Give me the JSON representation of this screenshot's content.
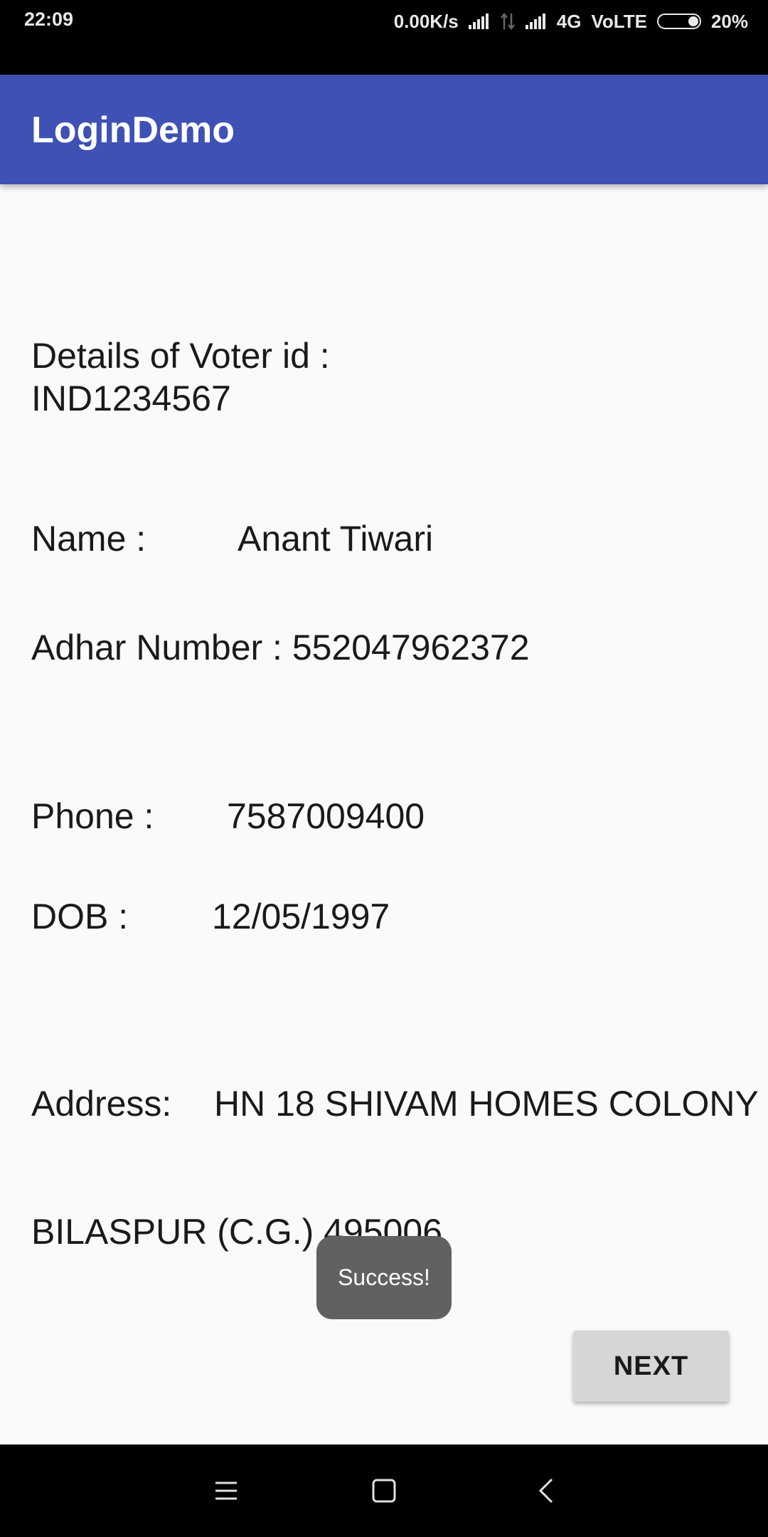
{
  "status_bar": {
    "time": "22:09",
    "speed": "0.00K/s",
    "network": "4G",
    "volte": "VoLTE",
    "battery": "20%"
  },
  "app_bar": {
    "title": "LoginDemo"
  },
  "details": {
    "heading": "Details of Voter id :\nIND1234567",
    "name_label": "Name :",
    "name_value": "Anant Tiwari",
    "adhar_text": "Adhar Number : 552047962372",
    "phone_label": "Phone :",
    "phone_value": "7587009400",
    "dob_label": "DOB :",
    "dob_value": "12/05/1997",
    "address_label": "Address:",
    "address_value": "HN 18 SHIVAM HOMES COLONY",
    "address_line2": "BILASPUR (C.G.) 495006"
  },
  "toast": {
    "message": "Success!"
  },
  "next_button": {
    "label": "NEXT"
  },
  "navigation": {
    "icons": [
      "menu-icon",
      "home-icon",
      "back-icon"
    ]
  }
}
